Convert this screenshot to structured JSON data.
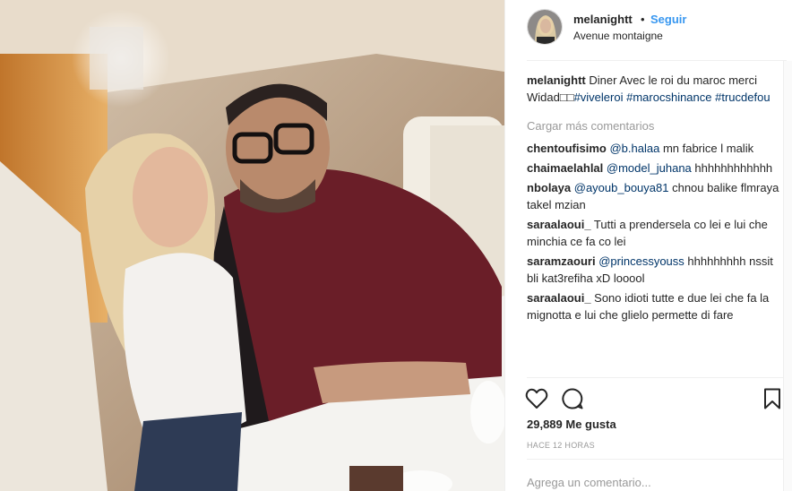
{
  "post": {
    "username": "melanightt",
    "separator": "•",
    "follow_label": "Seguir",
    "location": "Avenue montaigne",
    "caption": {
      "user": "melanightt",
      "text": "Diner Avec le roi du maroc merci Widad□□",
      "tags": [
        "#viveleroi",
        "#marocshinance",
        "#trucdefou"
      ]
    },
    "load_more": "Cargar más comentarios",
    "comments": [
      {
        "user": "chentoufisimo",
        "mention": "@b.halaa",
        "text": " mn fabrice l malik"
      },
      {
        "user": "chaimaelahlal",
        "mention": "@model_juhana",
        "text": " hhhhhhhhhhhh"
      },
      {
        "user": "nbolaya",
        "mention": "@ayoub_bouya81",
        "text": " chnou balike flmraya takel mzian"
      },
      {
        "user": "saraalaoui_",
        "mention": "",
        "text": " Tutti a prendersela co lei e lui che minchia ce fa co lei"
      },
      {
        "user": "saramzaouri",
        "mention": "@princessyouss",
        "text": " hhhhhhhhh nssit bli kat3refiha xD looool"
      },
      {
        "user": "saraalaoui_",
        "mention": "",
        "text": " Sono idioti tutte e due lei che fa la mignotta e lui che glielo permette di fare"
      }
    ],
    "likes": "29,889 Me gusta",
    "time": "HACE 12 HORAS",
    "add_comment_placeholder": "Agrega un comentario..."
  },
  "icons": {
    "like": "heart-icon",
    "comment": "comment-bubble-icon",
    "save": "bookmark-icon"
  },
  "colors": {
    "link": "#3897f0",
    "tag": "#003569",
    "muted": "#999999",
    "text": "#262626"
  }
}
